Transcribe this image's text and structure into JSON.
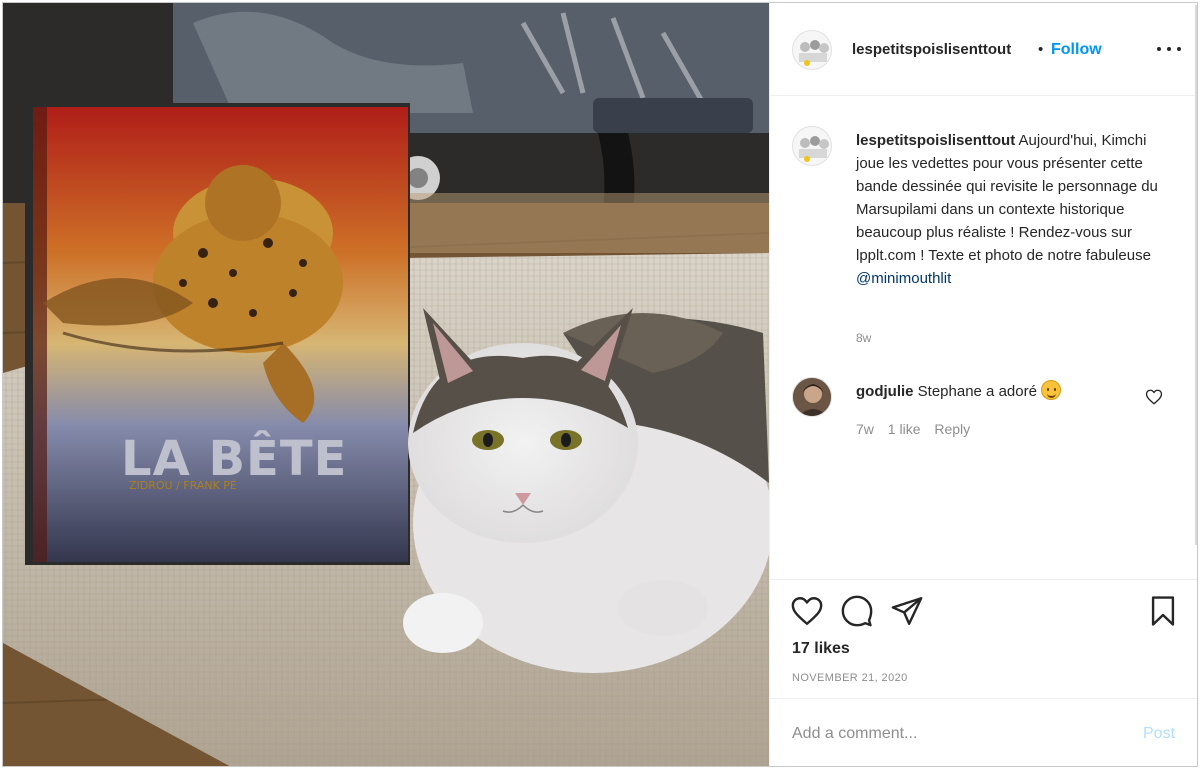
{
  "post": {
    "username": "lespetitspoislisenttout",
    "separator": "•",
    "follow_label": "Follow",
    "more_icon": "more-options-icon",
    "photo": {
      "book_title": "LA BÊTE",
      "book_authors": "ZIDROU / FRANK PÉ"
    },
    "caption": {
      "username": "lespetitspoislisenttout",
      "text": " Aujourd'hui, Kimchi joue les vedettes pour vous présenter cette bande dessinée qui revisite le personnage du Marsupilami dans un contexte historique beaucoup plus réaliste ! Rendez-vous sur lpplt.com ! Texte et photo de notre fabuleuse ",
      "mention": "@minimouthlit",
      "time": "8w"
    },
    "comments": [
      {
        "username": "godjulie",
        "text": " Stephane a adoré ",
        "emoji": "smiling-face-emoji",
        "time": "7w",
        "likes": "1 like",
        "reply_label": "Reply"
      }
    ],
    "actions": {
      "like_icon": "heart-icon",
      "comment_icon": "comment-icon",
      "share_icon": "paper-plane-icon",
      "save_icon": "bookmark-icon"
    },
    "likes": "17 likes",
    "date": "NOVEMBER 21, 2020",
    "add_comment": {
      "placeholder": "Add a comment...",
      "post_label": "Post"
    }
  },
  "colors": {
    "link_blue": "#0095f6",
    "post_disabled": "#b2dffc",
    "muted_text": "#8e8e8e",
    "mention": "#00376b"
  }
}
